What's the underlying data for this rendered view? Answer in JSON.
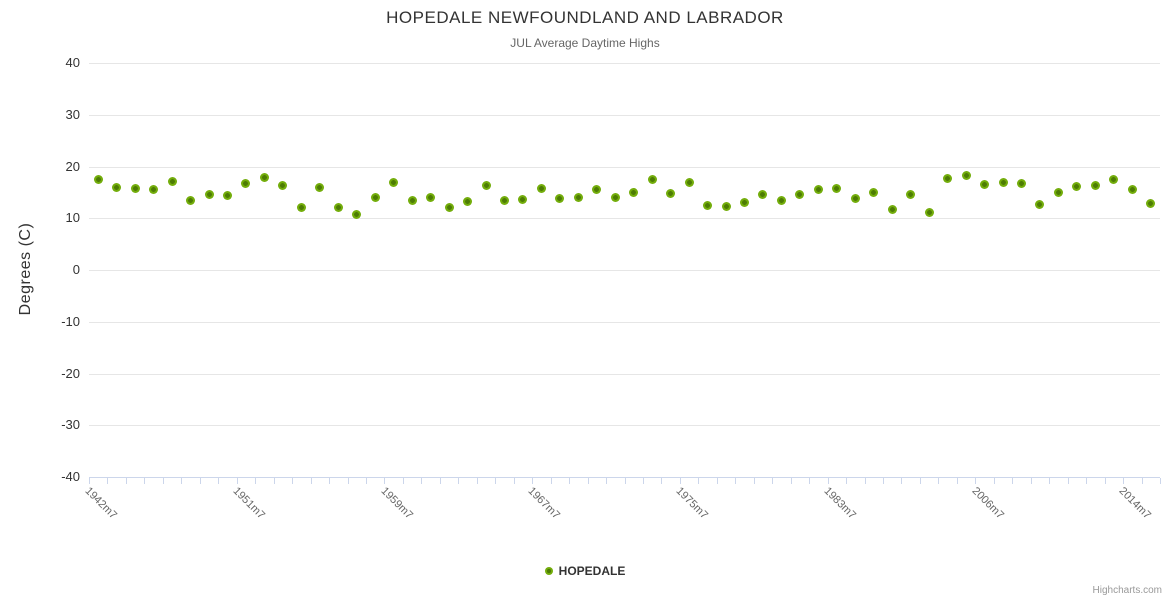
{
  "title": "HOPEDALE NEWFOUNDLAND AND LABRADOR",
  "subtitle": "JUL Average Daytime Highs",
  "legend": {
    "label": "HOPEDALE"
  },
  "credits": "Highcharts.com",
  "colors": {
    "marker_outer": "#73ad0b",
    "marker_inner": "#4d7c04",
    "gridline": "#e6e6e6",
    "axis_line": "#ccd6eb",
    "title_text": "#333333",
    "subtitle_text": "#666666"
  },
  "chart_data": {
    "type": "scatter",
    "title": "HOPEDALE NEWFOUNDLAND AND LABRADOR",
    "subtitle": "JUL Average Daytime Highs",
    "xlabel": "",
    "ylabel": "Degrees (C)",
    "ylim": [
      -40,
      40
    ],
    "yticks": [
      40,
      30,
      20,
      10,
      0,
      -10,
      -20,
      -30,
      -40
    ],
    "grid": true,
    "legend_position": "bottom-center",
    "n_points": 58,
    "xticks": [
      {
        "label": "1942m7",
        "index": 0
      },
      {
        "label": "1951m7",
        "index": 8
      },
      {
        "label": "1959m7",
        "index": 16
      },
      {
        "label": "1967m7",
        "index": 24
      },
      {
        "label": "1975m7",
        "index": 32
      },
      {
        "label": "1983m7",
        "index": 40
      },
      {
        "label": "2006m7",
        "index": 48
      },
      {
        "label": "2014m7",
        "index": 56
      }
    ],
    "series": [
      {
        "name": "HOPEDALE",
        "values": [
          17.5,
          16.0,
          15.7,
          15.5,
          17.1,
          13.4,
          14.6,
          14.3,
          16.8,
          17.9,
          16.4,
          12.0,
          16.0,
          12.1,
          10.8,
          14.0,
          17.0,
          13.4,
          14.0,
          12.1,
          13.3,
          16.3,
          13.5,
          13.7,
          15.8,
          13.8,
          14.0,
          15.6,
          14.1,
          15.0,
          17.4,
          14.7,
          16.9,
          12.5,
          12.3,
          13.1,
          14.6,
          13.5,
          14.6,
          15.5,
          15.8,
          13.8,
          14.9,
          11.6,
          14.6,
          11.2,
          17.7,
          18.3,
          16.5,
          17.0,
          16.8,
          12.7,
          15.0,
          16.1,
          16.4,
          17.4,
          15.6,
          12.9
        ]
      }
    ]
  }
}
